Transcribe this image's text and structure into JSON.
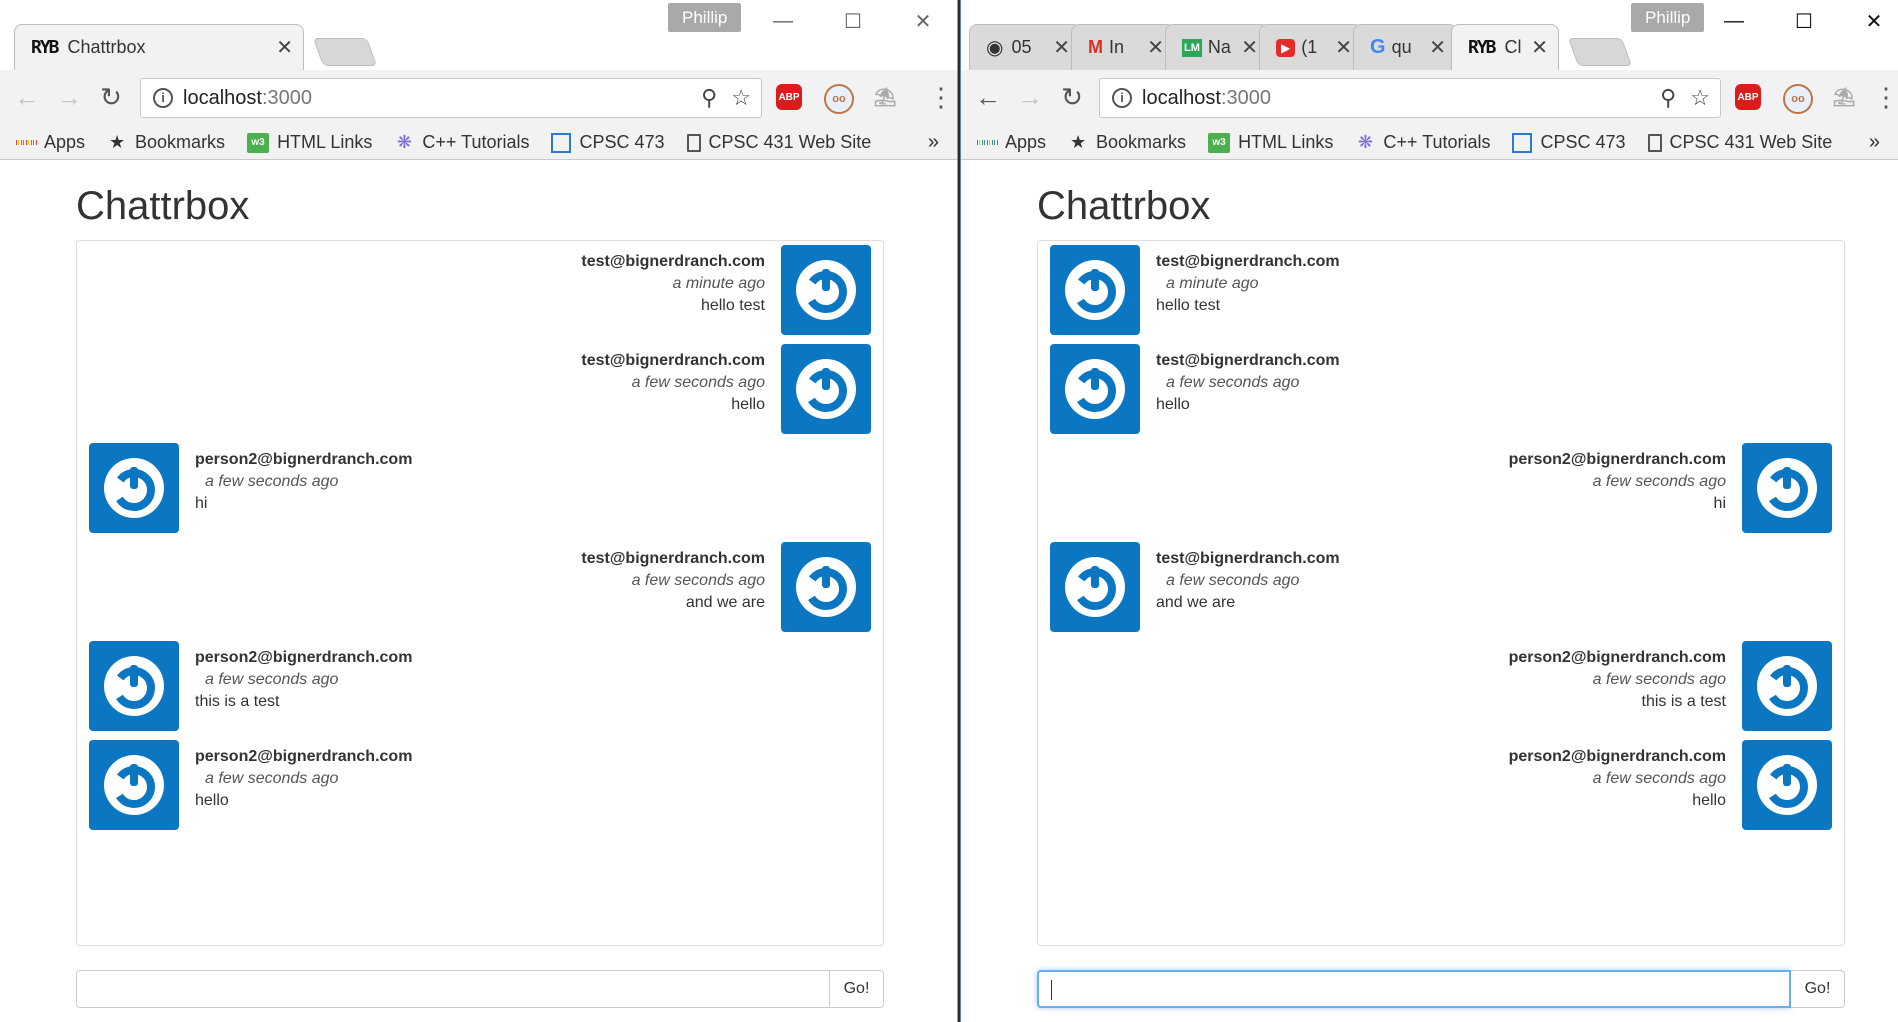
{
  "left": {
    "profile": "Phillip",
    "tabs": [
      {
        "title": "Chattrbox"
      }
    ],
    "url_host": "localhost",
    "url_port": ":3000",
    "app_title": "Chattrbox",
    "messages": [
      {
        "side": "right",
        "email": "test@bignerdranch.com",
        "time": "a minute ago",
        "text": "hello test"
      },
      {
        "side": "right",
        "email": "test@bignerdranch.com",
        "time": "a few seconds ago",
        "text": "hello"
      },
      {
        "side": "left",
        "email": "person2@bignerdranch.com",
        "time": "a few seconds ago",
        "text": "hi"
      },
      {
        "side": "right",
        "email": "test@bignerdranch.com",
        "time": "a few seconds ago",
        "text": "and we are"
      },
      {
        "side": "left",
        "email": "person2@bignerdranch.com",
        "time": "a few seconds ago",
        "text": "this is a test"
      },
      {
        "side": "left",
        "email": "person2@bignerdranch.com",
        "time": "a few seconds ago",
        "text": "hello"
      }
    ],
    "send_label": "Go!"
  },
  "right": {
    "profile": "Phillip",
    "tabs": [
      {
        "title": "05",
        "icon": "github-icon"
      },
      {
        "title": "In",
        "icon": "gmail-icon"
      },
      {
        "title": "Na",
        "icon": "lm-icon"
      },
      {
        "title": "(1",
        "icon": "youtube-icon"
      },
      {
        "title": "qu",
        "icon": "google-icon"
      },
      {
        "title": "Cl",
        "icon": "ryb-icon"
      }
    ],
    "url_host": "localhost",
    "url_port": ":3000",
    "app_title": "Chattrbox",
    "messages": [
      {
        "side": "left",
        "email": "test@bignerdranch.com",
        "time": "a minute ago",
        "text": "hello test"
      },
      {
        "side": "left",
        "email": "test@bignerdranch.com",
        "time": "a few seconds ago",
        "text": "hello"
      },
      {
        "side": "right",
        "email": "person2@bignerdranch.com",
        "time": "a few seconds ago",
        "text": "hi"
      },
      {
        "side": "left",
        "email": "test@bignerdranch.com",
        "time": "a few seconds ago",
        "text": "and we are"
      },
      {
        "side": "right",
        "email": "person2@bignerdranch.com",
        "time": "a few seconds ago",
        "text": "this is a test"
      },
      {
        "side": "right",
        "email": "person2@bignerdranch.com",
        "time": "a few seconds ago",
        "text": "hello"
      }
    ],
    "send_label": "Go!"
  },
  "bookmarks": [
    "Apps",
    "Bookmarks",
    "HTML Links",
    "C++ Tutorials",
    "CPSC 473",
    "CPSC 431 Web Site"
  ],
  "bookmarks_overflow": "»",
  "ryb_logo": "RYB",
  "colors": {
    "avatar": "#0b77c2",
    "focus": "#66afe9"
  }
}
